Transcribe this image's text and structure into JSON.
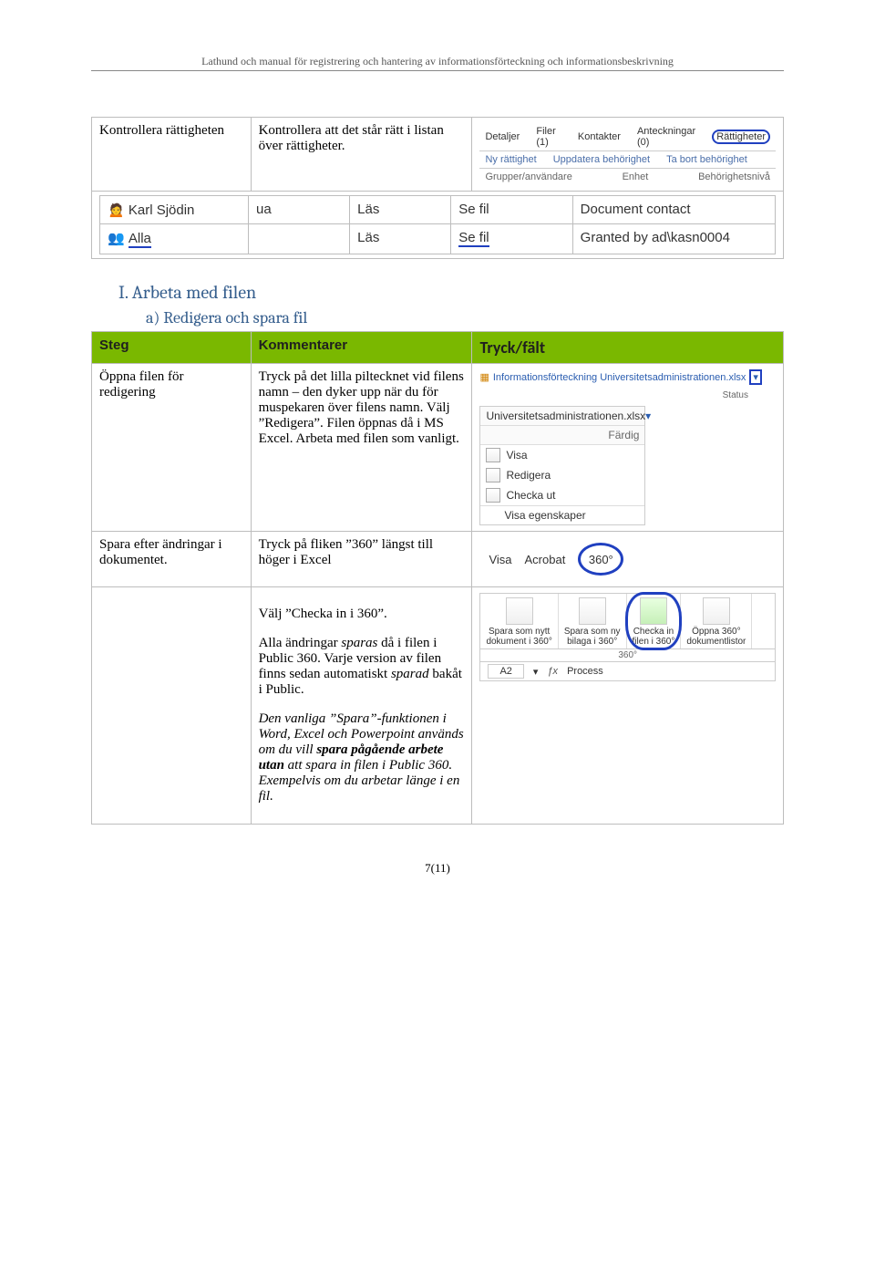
{
  "header": "Lathund och manual för registrering och hantering av informationsförteckning och informationsbeskrivning",
  "row1": {
    "steg": "Kontrollera rättigheten",
    "komm": "Kontrollera att det står rätt i listan över rättigheter."
  },
  "ui_tabs": {
    "tabs": [
      "Detaljer",
      "Filer (1)",
      "Kontakter",
      "Anteckningar (0)",
      "Rättigheter"
    ],
    "actions": [
      "Ny rättighet",
      "Uppdatera behörighet",
      "Ta bort behörighet"
    ],
    "labels": [
      "Grupper/användare",
      "Enhet",
      "Behörighetsnivå"
    ]
  },
  "perm_table": {
    "cols": [
      "",
      "ua",
      "Läs",
      "Se fil",
      ""
    ],
    "rows": [
      [
        "Karl Sjödin",
        "ua",
        "Läs",
        "Se fil",
        "Document contact"
      ],
      [
        "Alla",
        "",
        "Läs",
        "Se fil",
        "Granted by ad\\kasn0004"
      ]
    ]
  },
  "section_I": "I.   Arbeta med filen",
  "subsection_a": "a)  Redigera och spara fil",
  "table_head": {
    "c1": "Steg",
    "c2": "Kommentarer",
    "c3": "Tryck/fält"
  },
  "row_open": {
    "steg": "Öppna filen för redigering",
    "komm": "Tryck på det lilla piltecknet vid filens namn – den dyker upp när du för muspekaren över filens namn. Välj ”Redigera”. Filen öppnas då i MS Excel. Arbeta med filen som vanligt."
  },
  "crumb": {
    "doc": "Informationsförteckning Universitetsadministrationen.xlsx",
    "status_lbl": "Status"
  },
  "dropdown": {
    "file": "Universitetsadministrationen.xlsx",
    "status": "Färdig",
    "items": [
      "Visa",
      "Redigera",
      "Checka ut",
      "Visa egenskaper"
    ]
  },
  "row_save": {
    "steg": "Spara efter ändringar i dokumentet.",
    "komm": "Tryck på fliken ”360” längst till höger i Excel"
  },
  "excel_tabs": [
    "Visa",
    "Acrobat",
    "360°"
  ],
  "row_checkin": {
    "p1": "Välj ”Checka in i 360”.",
    "p2a": "Alla ändringar ",
    "p2b": "sparas",
    "p2c": " då i filen i Public 360. Varje version av filen finns sedan automatiskt ",
    "p2d": "sparad",
    "p2e": " bakåt i Public.",
    "p3a": "Den vanliga ”Spara”-funktionen i Word, Excel och Powerpoint används om du vill ",
    "p3b": "spara pågående arbete utan",
    "p3c": " att spara in filen i Public 360. Exempelvis om du arbetar länge i en fil."
  },
  "ribbon": {
    "groups": [
      {
        "l1": "Spara som nytt",
        "l2": "dokument i 360°"
      },
      {
        "l1": "Spara som ny",
        "l2": "bilaga i 360°"
      },
      {
        "l1": "Checka in",
        "l2": "filen i 360°"
      },
      {
        "l1": "Öppna 360°",
        "l2": "dokumentlistor"
      }
    ],
    "grouplabel": "360°",
    "cell": "A2",
    "fx": "ƒx",
    "val": "Process"
  },
  "footer": "7(11)"
}
